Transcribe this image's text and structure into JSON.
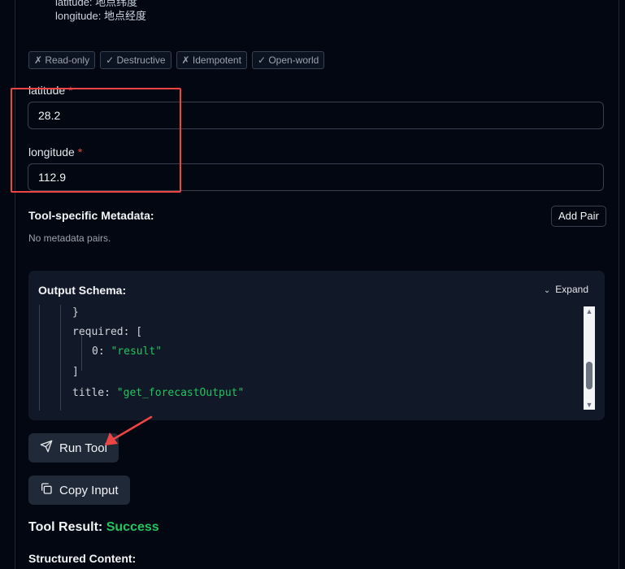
{
  "params": {
    "lat_desc": "latitude: 地点纬度",
    "lon_desc": "longitude: 地点经度"
  },
  "badges": [
    "✗ Read-only",
    "✓ Destructive",
    "✗ Idempotent",
    "✓ Open-world"
  ],
  "fields": {
    "latitude": {
      "label": "latitude",
      "required_mark": "*",
      "value": "28.2"
    },
    "longitude": {
      "label": "longitude",
      "required_mark": "*",
      "value": "112.9"
    }
  },
  "metadata": {
    "title": "Tool-specific Metadata:",
    "add_pair_label": "Add Pair",
    "empty_text": "No metadata pairs."
  },
  "output_schema": {
    "title": "Output Schema:",
    "expand_label": "Expand",
    "lines": {
      "close_brace": "}",
      "required_key": "required:",
      "open_bracket": "[",
      "item_index": "0:",
      "item_value": "\"result\"",
      "close_bracket": "]",
      "title_key": "title:",
      "title_value": "\"get_forecastOutput\""
    }
  },
  "actions": {
    "run_tool_label": "Run Tool",
    "copy_input_label": "Copy Input"
  },
  "result": {
    "title": "Tool Result:",
    "status": "Success",
    "structured_label": "Structured Content:"
  },
  "colors": {
    "background": "#030712",
    "success": "#22c55e",
    "annotation": "#ef4444"
  },
  "icons": [
    "send-icon",
    "copy-icon",
    "chevron-down-icon"
  ]
}
